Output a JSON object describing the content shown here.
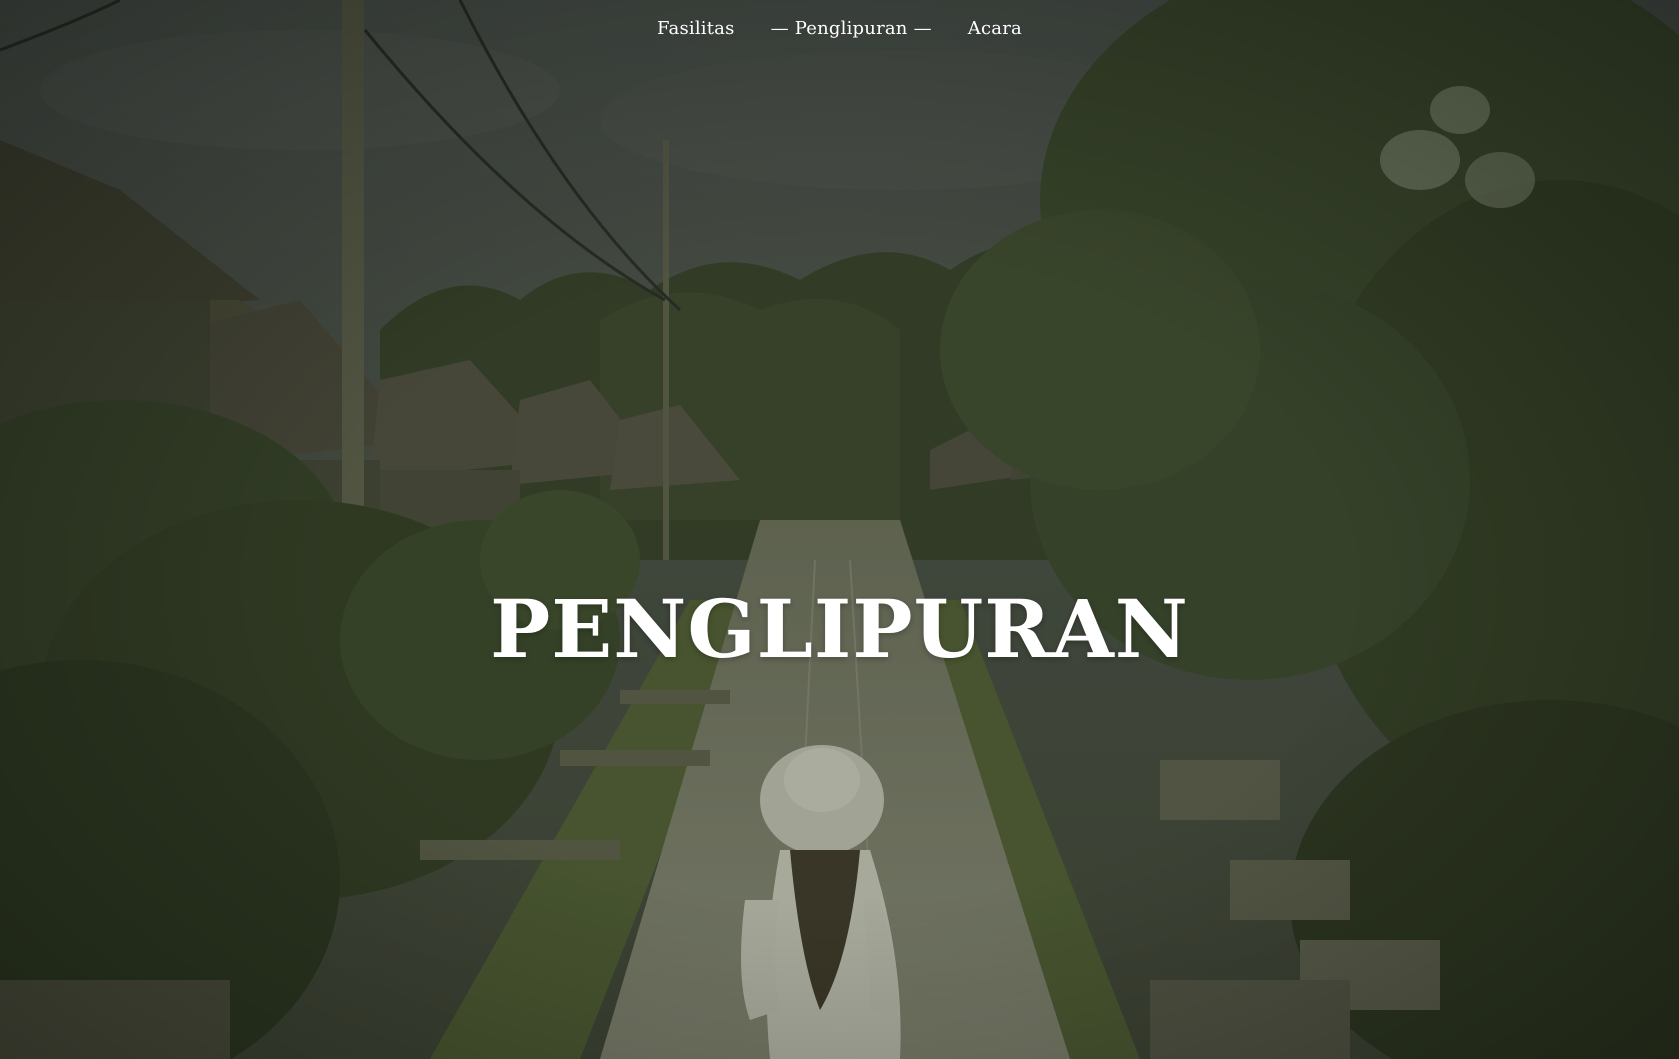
{
  "nav": {
    "items": [
      {
        "label": "Fasilitas",
        "active": false
      },
      {
        "label": "Penglipuran",
        "active": true
      },
      {
        "label": "Acara",
        "active": false
      }
    ],
    "active_prefix": "—",
    "active_suffix": "—"
  },
  "hero": {
    "title": "PENGLIPURAN"
  },
  "colors": {
    "overlay_green": "#3a4428",
    "text": "#ffffff"
  }
}
